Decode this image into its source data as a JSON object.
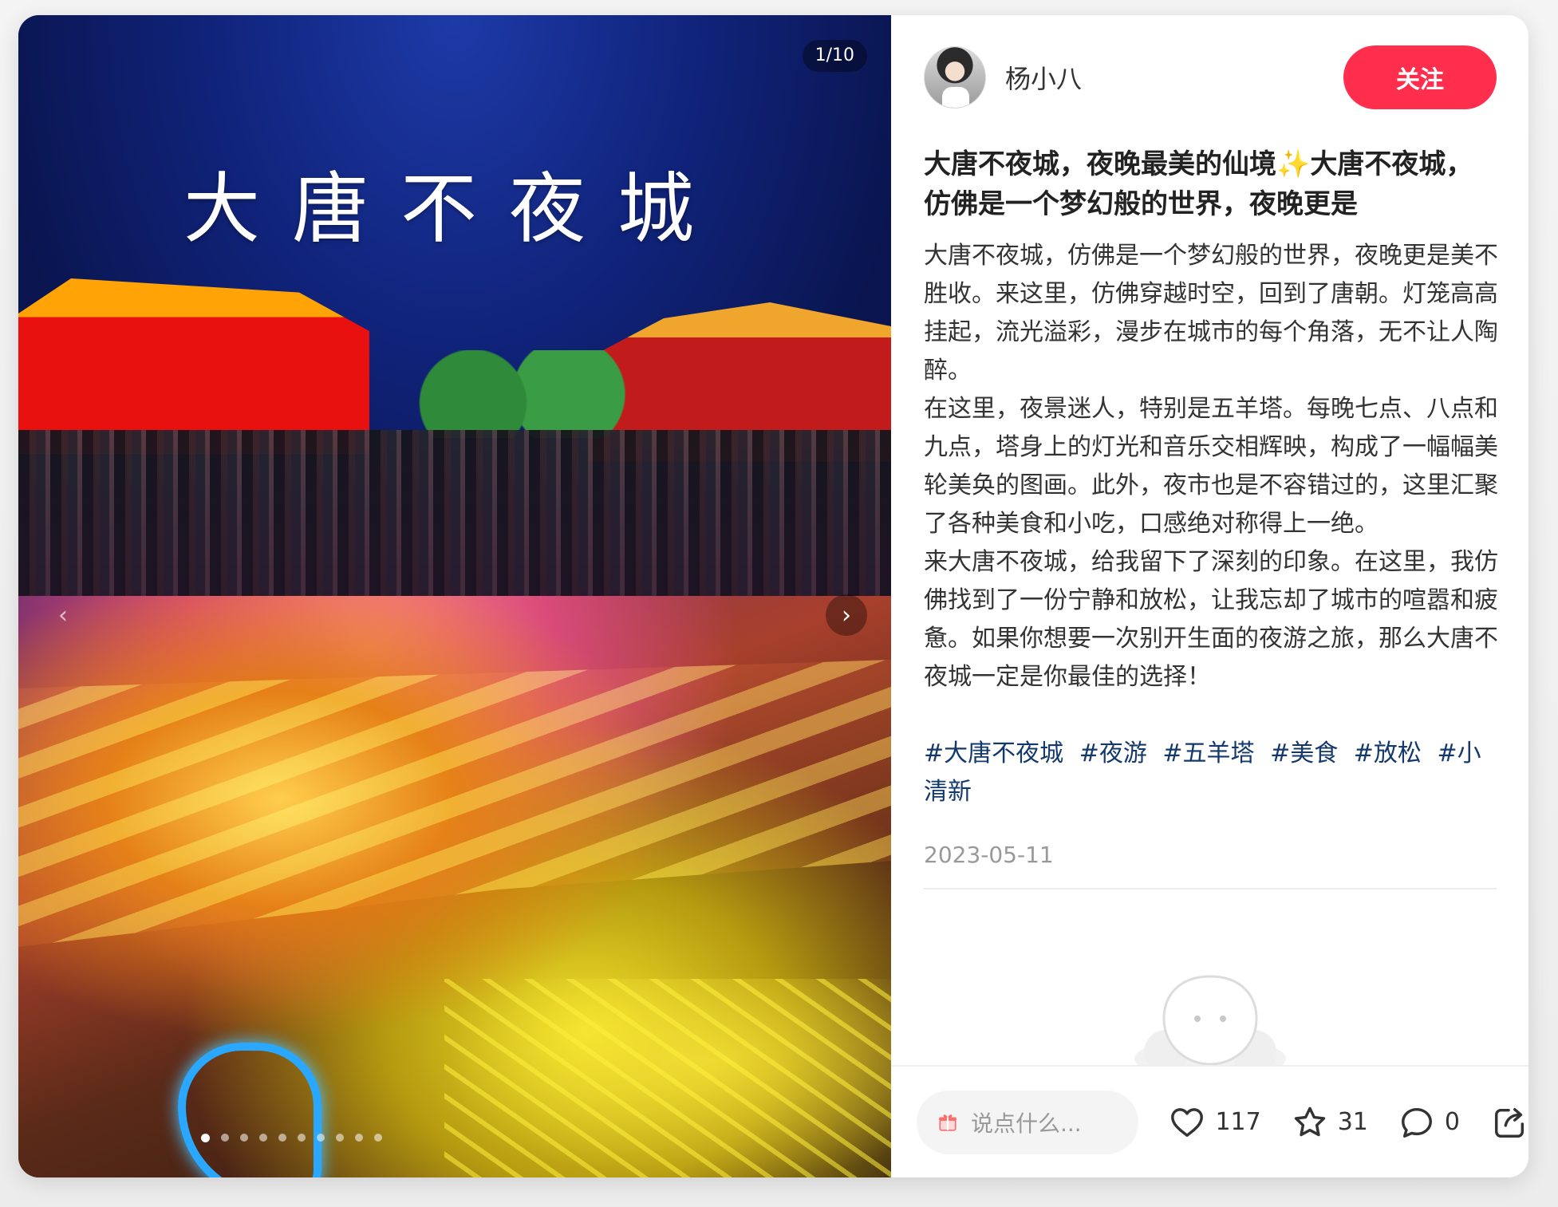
{
  "media": {
    "counter": "1/10",
    "image_title": "大唐不夜城",
    "dot_count": 10,
    "active_dot": 0
  },
  "author": {
    "name": "杨小八",
    "follow_label": "关注"
  },
  "note": {
    "title": "大唐不夜城，夜晚最美的仙境✨大唐不夜城，仿佛是一个梦幻般的世界，夜晚更是",
    "paragraphs": [
      "大唐不夜城，仿佛是一个梦幻般的世界，夜晚更是美不胜收。来这里，仿佛穿越时空，回到了唐朝。灯笼高高挂起，流光溢彩，漫步在城市的每个角落，无不让人陶醉。",
      "在这里，夜景迷人，特别是五羊塔。每晚七点、八点和九点，塔身上的灯光和音乐交相辉映，构成了一幅幅美轮美奂的图画。此外，夜市也是不容错过的，这里汇聚了各种美食和小吃，口感绝对称得上一绝。",
      "来大唐不夜城，给我留下了深刻的印象。在这里，我仿佛找到了一份宁静和放松，让我忘却了城市的喧嚣和疲惫。如果你想要一次别开生面的夜游之旅，那么大唐不夜城一定是你最佳的选择！"
    ],
    "tags": [
      "#大唐不夜城",
      "#夜游",
      "#五羊塔",
      "#美食",
      "#放松",
      "#小清新"
    ],
    "date": "2023-05-11"
  },
  "bottom_bar": {
    "comment_placeholder": "说点什么...",
    "likes": "117",
    "collects": "31",
    "comments": "0"
  },
  "colors": {
    "accent": "#ff2e4d",
    "tag": "#13386c"
  }
}
